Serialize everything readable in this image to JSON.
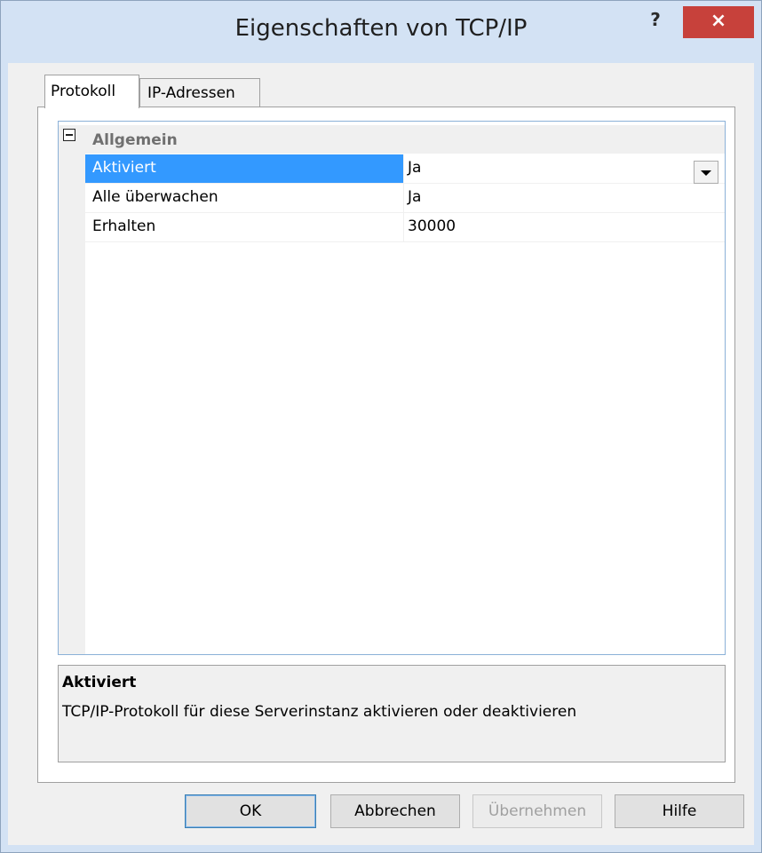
{
  "window": {
    "title": "Eigenschaften von TCP/IP",
    "help_glyph": "?",
    "close_glyph": "×"
  },
  "tabs": [
    {
      "label": "Protokoll",
      "active": true
    },
    {
      "label": "IP-Adressen",
      "active": false
    }
  ],
  "property_grid": {
    "category": {
      "label": "Allgemein",
      "expanded": true,
      "toggle_icon": "collapse-minus-icon"
    },
    "properties": [
      {
        "name": "Aktiviert",
        "value": "Ja",
        "selected": true,
        "editor": "dropdown"
      },
      {
        "name": "Alle überwachen",
        "value": "Ja",
        "selected": false
      },
      {
        "name": "Erhalten",
        "value": "30000",
        "selected": false
      }
    ]
  },
  "description": {
    "title": "Aktiviert",
    "text": "TCP/IP-Protokoll für diese Serverinstanz aktivieren oder deaktivieren"
  },
  "buttons": {
    "ok": "OK",
    "cancel": "Abbrechen",
    "apply": "Übernehmen",
    "help": "Hilfe"
  },
  "colors": {
    "titlebar": "#d3e2f4",
    "close_button": "#c7413b",
    "selection": "#3399ff",
    "grid_border": "#8bb1d8"
  }
}
